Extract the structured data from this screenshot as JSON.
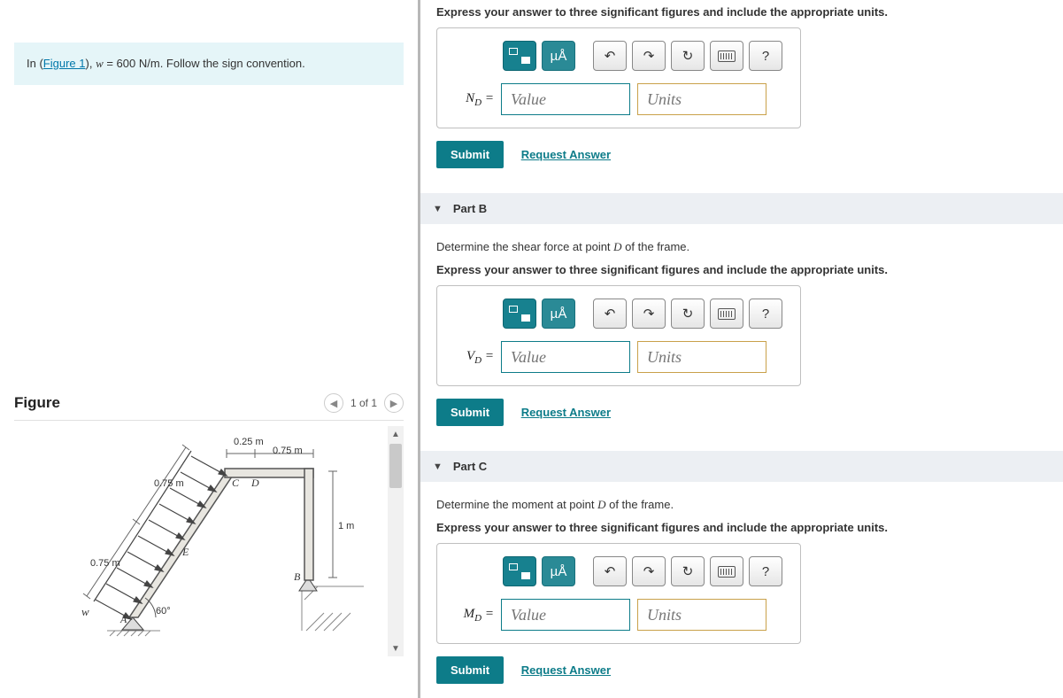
{
  "left": {
    "prompt_prefix": "In (",
    "figure_link": "Figure 1",
    "prompt_mid": "), ",
    "var": "w",
    "eq": " = 600 N/m",
    "prompt_suffix": ". Follow the sign convention."
  },
  "figure": {
    "title": "Figure",
    "pager": "1 of 1",
    "labels": {
      "d025": "0.25 m",
      "d075top": "0.75 m",
      "d075l1": "0.75 m",
      "d075l2": "0.75 m",
      "d1m": "1 m",
      "sixty": "60°",
      "w": "w",
      "A": "A",
      "B": "B",
      "C": "C",
      "D": "D",
      "E": "E"
    }
  },
  "toolbar": {
    "mu": "µÅ",
    "undo": "↶",
    "redo": "↷",
    "reset": "↻",
    "help": "?"
  },
  "inputs": {
    "value_ph": "Value",
    "units_ph": "Units"
  },
  "common": {
    "instr": "Express your answer to three significant figures and include the appropriate units.",
    "submit": "Submit",
    "request": "Request Answer"
  },
  "partA": {
    "var_html": "N",
    "sub": "D",
    "eq": " ="
  },
  "partB": {
    "title": "Part B",
    "desc_pre": "Determine the shear force at point ",
    "desc_pt": "D",
    "desc_post": " of the frame.",
    "var_html": "V",
    "sub": "D",
    "eq": " ="
  },
  "partC": {
    "title": "Part C",
    "desc_pre": "Determine the moment at point ",
    "desc_pt": "D",
    "desc_post": " of the frame.",
    "var_html": "M",
    "sub": "D",
    "eq": " ="
  }
}
